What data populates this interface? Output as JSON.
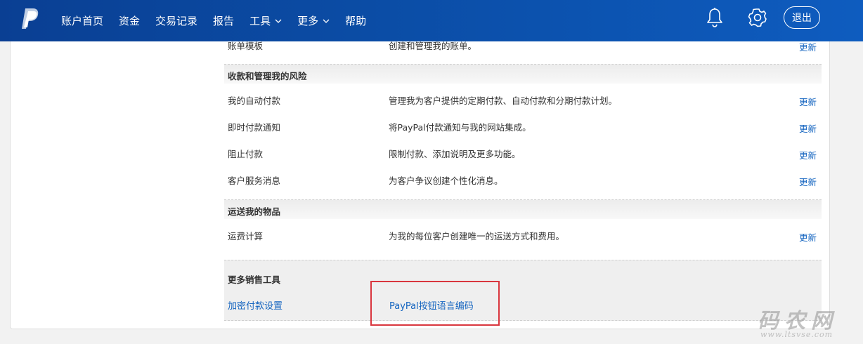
{
  "nav": {
    "brand_logo": "paypal-logo-icon",
    "items": [
      {
        "label": "账户首页",
        "has_dropdown": false
      },
      {
        "label": "资金",
        "has_dropdown": false
      },
      {
        "label": "交易记录",
        "has_dropdown": false
      },
      {
        "label": "报告",
        "has_dropdown": false
      },
      {
        "label": "工具",
        "has_dropdown": true
      },
      {
        "label": "更多",
        "has_dropdown": true
      },
      {
        "label": "帮助",
        "has_dropdown": false
      }
    ],
    "notifications_icon": "bell-icon",
    "settings_icon": "gear-icon",
    "logout_label": "退出"
  },
  "tools": {
    "top_row": {
      "name": "账单模板",
      "desc": "创建和管理我的账单。",
      "action": "更新"
    },
    "section_risk": {
      "title": "收款和管理我的风险",
      "rows": [
        {
          "name": "我的自动付款",
          "desc": "管理我为客户提供的定期付款、自动付款和分期付款计划。",
          "action": "更新"
        },
        {
          "name": "即时付款通知",
          "desc": "将PayPal付款通知与我的网站集成。",
          "action": "更新"
        },
        {
          "name": "阻止付款",
          "desc": "限制付款、添加说明及更多功能。",
          "action": "更新"
        },
        {
          "name": "客户服务消息",
          "desc": "为客户争议创建个性化消息。",
          "action": "更新"
        }
      ]
    },
    "section_shipping": {
      "title": "运送我的物品",
      "rows": [
        {
          "name": "运费计算",
          "desc": "为我的每位客户创建唯一的运送方式和费用。",
          "action": "更新"
        }
      ]
    },
    "section_more": {
      "title": "更多销售工具",
      "link1": "加密付款设置",
      "link2": "PayPal按钮语言编码"
    }
  },
  "watermark": {
    "big": "码农网",
    "small": "www.ltsvse.com"
  },
  "colors": {
    "nav_bg": "#0b4da6",
    "link": "#1565c0",
    "highlight_box": "#d9363e"
  }
}
